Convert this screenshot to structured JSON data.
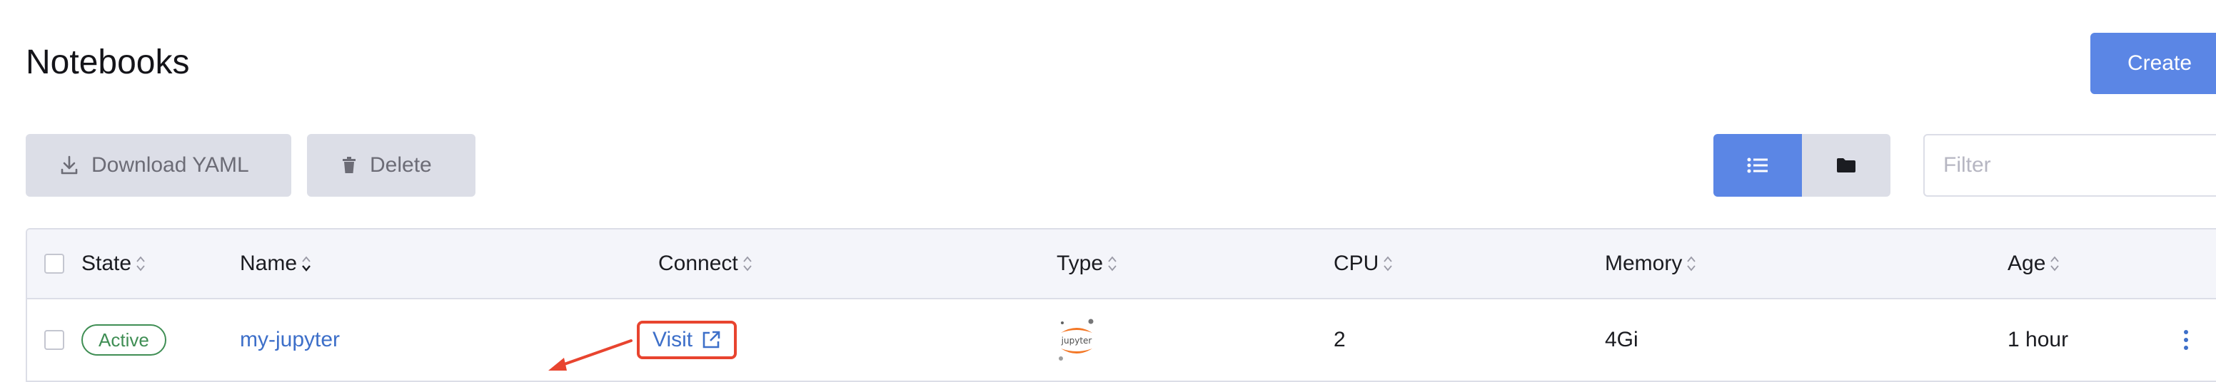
{
  "page": {
    "title": "Notebooks"
  },
  "toolbar": {
    "create_label": "Create",
    "download_label": "Download YAML",
    "delete_label": "Delete",
    "filter_placeholder": "Filter"
  },
  "table": {
    "columns": {
      "state": "State",
      "name": "Name",
      "connect": "Connect",
      "type": "Type",
      "cpu": "CPU",
      "memory": "Memory",
      "age": "Age"
    },
    "rows": [
      {
        "state": "Active",
        "name": "my-jupyter",
        "connect": "Visit",
        "type": "jupyter",
        "cpu": "2",
        "memory": "4Gi",
        "age": "1 hour"
      }
    ]
  },
  "colors": {
    "primary": "#5b86e5",
    "active_badge": "#3f8e54",
    "link": "#3d6fc9",
    "highlight": "#e8442f",
    "jupyter_orange": "#f37726"
  }
}
